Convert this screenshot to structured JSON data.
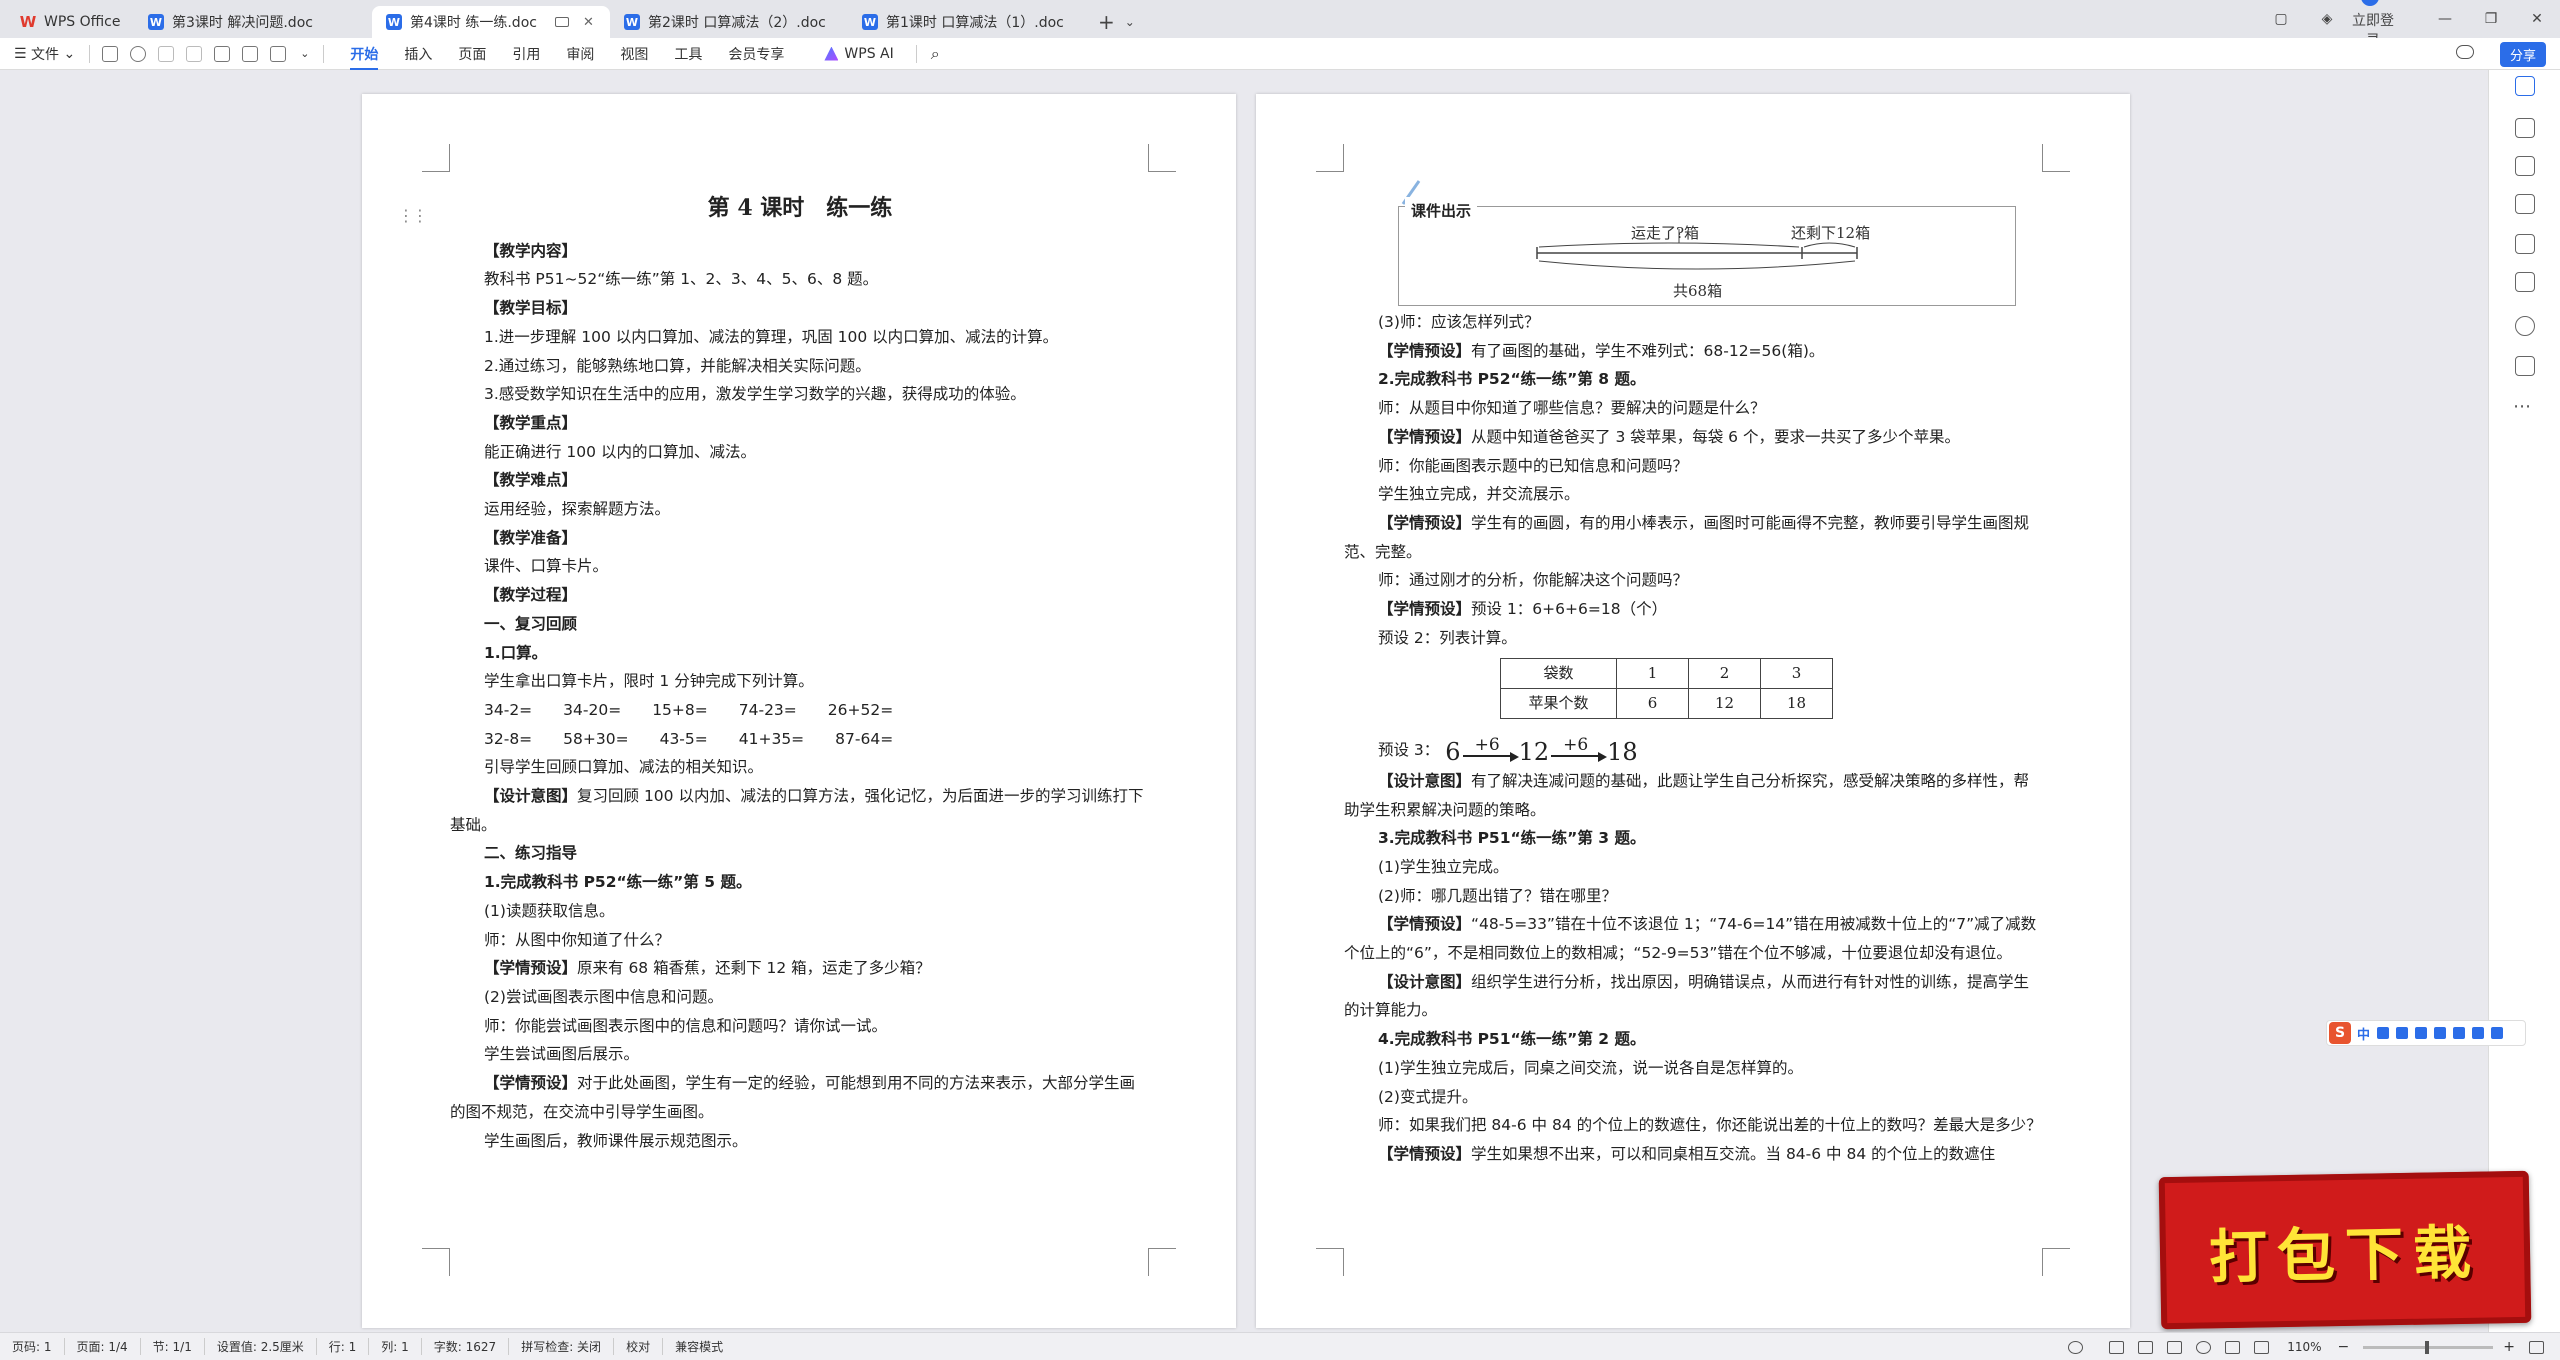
{
  "tabs": [
    {
      "label": "WPS Office",
      "type": "wps"
    },
    {
      "label": "第3课时  解决问题.doc",
      "type": "doc"
    },
    {
      "label": "第4课时  练一练.doc",
      "type": "doc",
      "active": true
    },
    {
      "label": "第2课时  口算减法（2）.doc",
      "type": "doc"
    },
    {
      "label": "第1课时  口算减法（1）.doc",
      "type": "doc"
    }
  ],
  "header": {
    "login": "立即登录",
    "share": "分享"
  },
  "toolbar": {
    "file": "文件",
    "menus": [
      "开始",
      "插入",
      "页面",
      "引用",
      "审阅",
      "视图",
      "工具",
      "会员专享"
    ],
    "ai": "WPS AI"
  },
  "left_page": {
    "title": "第 4 课时　练一练",
    "lines": [
      {
        "t": "【教学内容】",
        "b": true
      },
      {
        "t": "教科书 P51~52“练一练”第 1、2、3、4、5、6、8 题。"
      },
      {
        "t": "【教学目标】",
        "b": true
      },
      {
        "t": "1.进一步理解 100 以内口算加、减法的算理，巩固 100 以内口算加、减法的计算。"
      },
      {
        "t": "2.通过练习，能够熟练地口算，并能解决相关实际问题。"
      },
      {
        "t": "3.感受数学知识在生活中的应用，激发学生学习数学的兴趣，获得成功的体验。"
      },
      {
        "t": "【教学重点】",
        "b": true
      },
      {
        "t": "能正确进行 100 以内的口算加、减法。"
      },
      {
        "t": "【教学难点】",
        "b": true
      },
      {
        "t": "运用经验，探索解题方法。"
      },
      {
        "t": "【教学准备】",
        "b": true
      },
      {
        "t": "课件、口算卡片。"
      },
      {
        "t": "【教学过程】",
        "b": true
      },
      {
        "t": "一、复习回顾",
        "b": true
      },
      {
        "t": "1.口算。",
        "b": true
      },
      {
        "t": "学生拿出口算卡片，限时 1 分钟完成下列计算。"
      },
      {
        "t": "34-2=　　34-20=　　15+8=　　74-23=　　26+52="
      },
      {
        "t": "32-8=　　58+30=　　43-5=　　41+35=　　87-64="
      },
      {
        "t": "引导学生回顾口算加、减法的相关知识。"
      },
      {
        "t": "【设计意图】复习回顾 100 以内加、减法的口算方法，强化记忆，为后面进一步的学习训练打下基础。",
        "wrap": true,
        "lead": "【设计意图】"
      },
      {
        "t": "二、练习指导",
        "b": true
      },
      {
        "t": "1.完成教科书 P52“练一练”第 5 题。",
        "b": true
      },
      {
        "t": "(1)读题获取信息。"
      },
      {
        "t": "师：从图中你知道了什么？"
      },
      {
        "t": "【学情预设】原来有 68 箱香蕉，还剩下 12 箱，运走了多少箱？",
        "lead": "【学情预设】"
      },
      {
        "t": "(2)尝试画图表示图中信息和问题。"
      },
      {
        "t": "师：你能尝试画图表示图中的信息和问题吗？请你试一试。"
      },
      {
        "t": "学生尝试画图后展示。"
      },
      {
        "t": "【学情预设】对于此处画图，学生有一定的经验，可能想到用不同的方法来表示，大部分学生画的图不规范，在交流中引导学生画图。",
        "wrap": true,
        "lead": "【学情预设】"
      },
      {
        "t": "学生画图后，教师课件展示规范图示。"
      }
    ]
  },
  "right_page": {
    "figure": {
      "caption": "课件出示",
      "left": "运走了?箱",
      "right": "还剩下12箱",
      "total": "共68箱"
    },
    "lines_a": [
      {
        "t": "(3)师：应该怎样列式？"
      },
      {
        "t": "【学情预设】有了画图的基础，学生不难列式：68-12=56(箱)。",
        "lead": "【学情预设】"
      },
      {
        "t": "2.完成教科书 P52“练一练”第 8 题。",
        "b": true
      },
      {
        "t": "师：从题目中你知道了哪些信息？要解决的问题是什么？"
      },
      {
        "t": "【学情预设】从题中知道爸爸买了 3 袋苹果，每袋 6 个，要求一共买了多少个苹果。",
        "lead": "【学情预设】"
      },
      {
        "t": "师：你能画图表示题中的已知信息和问题吗？"
      },
      {
        "t": "学生独立完成，并交流展示。"
      },
      {
        "t": "【学情预设】学生有的画圆，有的用小棒表示，画图时可能画得不完整，教师要引导学生画图规范、完整。",
        "wrap": true,
        "lead": "【学情预设】"
      },
      {
        "t": "师：通过刚才的分析，你能解决这个问题吗？"
      },
      {
        "t": "【学情预设】预设 1：6+6+6=18（个）",
        "lead": "【学情预设】"
      },
      {
        "t": "预设 2：列表计算。"
      }
    ],
    "table": {
      "rows": [
        [
          "袋数",
          "1",
          "2",
          "3"
        ],
        [
          "苹果个数",
          "6",
          "12",
          "18"
        ]
      ]
    },
    "preset3": {
      "label": "预设 3：",
      "n1": "6",
      "a1": "+6",
      "n2": "12",
      "a2": "+6",
      "n3": "18"
    },
    "lines_b": [
      {
        "t": "【设计意图】有了解决连减问题的基础，此题让学生自己分析探究，感受解决策略的多样性，帮助学生积累解决问题的策略。",
        "wrap": true,
        "lead": "【设计意图】"
      },
      {
        "t": "3.完成教科书 P51“练一练”第 3 题。",
        "b": true
      },
      {
        "t": "(1)学生独立完成。"
      },
      {
        "t": "(2)师：哪几题出错了？错在哪里？"
      },
      {
        "t": "【学情预设】“48-5=33”错在十位不该退位 1；“74-6=14”错在用被减数十位上的“7”减了减数个位上的“6”，不是相同数位上的数相减；“52-9=53”错在个位不够减，十位要退位却没有退位。",
        "wrap": true,
        "lead": "【学情预设】"
      },
      {
        "t": "【设计意图】组织学生进行分析，找出原因，明确错误点，从而进行有针对性的训练，提高学生的计算能力。",
        "wrap": true,
        "lead": "【设计意图】"
      },
      {
        "t": "4.完成教科书 P51“练一练”第 2 题。",
        "b": true
      },
      {
        "t": "(1)学生独立完成后，同桌之间交流，说一说各自是怎样算的。"
      },
      {
        "t": "(2)变式提升。"
      },
      {
        "t": "师：如果我们把 84-6 中 84 的个位上的数遮住，你还能说出差的十位上的数吗？差最大是多少？",
        "wrap": true
      },
      {
        "t": "【学情预设】学生如果想不出来，可以和同桌相互交流。当 84-6 中 84 的个位上的数遮住",
        "lead": "【学情预设】"
      }
    ]
  },
  "ime": {
    "logo": "S",
    "mode": "中"
  },
  "stamp": "打包下载",
  "status": {
    "items": [
      "页码: 1",
      "页面: 1/4",
      "节: 1/1",
      "设置值: 2.5厘米",
      "行: 1",
      "列: 1",
      "字数: 1627",
      "拼写检查: 关闭",
      "校对",
      "兼容模式"
    ],
    "zoom": "110%"
  }
}
